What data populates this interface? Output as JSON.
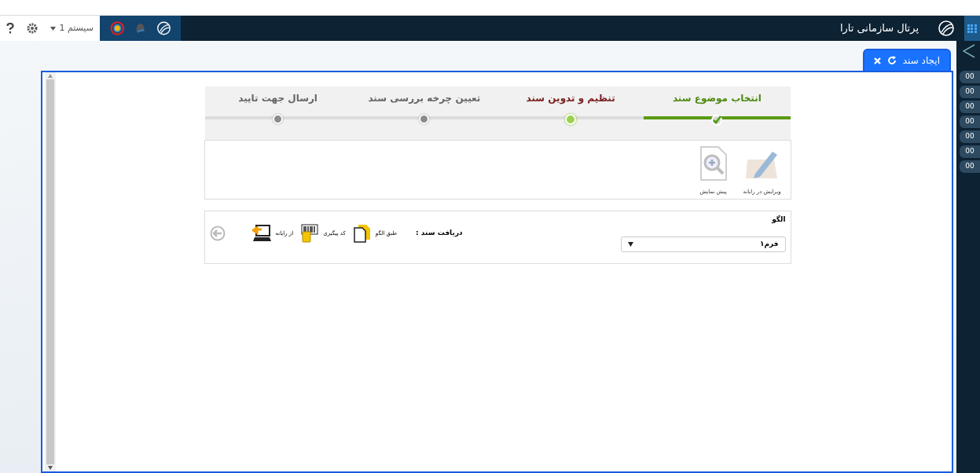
{
  "top_bar": {
    "user_menu": "سیستم 1",
    "portal_title": "پرتال سازمانی تارا"
  },
  "tab": {
    "label": "ایجاد سند",
    "selected": true
  },
  "side_badges": [
    "00",
    "00",
    "00",
    "00",
    "00",
    "00",
    "00"
  ],
  "steps": [
    {
      "label": "انتخاب موضوع سند",
      "done": true,
      "selected": false
    },
    {
      "label": "تنظیم و تدوین سند",
      "done": false,
      "selected": true
    },
    {
      "label": "تعیین چرخه بررسی سند",
      "done": false,
      "selected": false
    },
    {
      "label": "ارسال جهت تایید",
      "done": false,
      "selected": false
    }
  ],
  "tools": [
    {
      "kind": "edit",
      "label": "ویرایش در رایانه"
    },
    {
      "kind": "preview",
      "label": "پیش نمایش"
    }
  ],
  "template": {
    "label": "الگو",
    "value": "فرم۱"
  },
  "receive": {
    "label": "دریافت سند :",
    "options": [
      {
        "kind": "template",
        "label": "طبق الگو"
      },
      {
        "kind": "tracking",
        "label": "کد پیگیری"
      },
      {
        "kind": "computer",
        "label": "از رایانه"
      }
    ]
  }
}
